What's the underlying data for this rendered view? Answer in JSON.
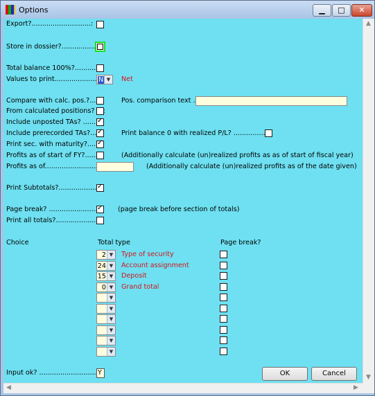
{
  "window": {
    "title": "Options"
  },
  "fields": {
    "export": {
      "label": "Export?............................:",
      "checked": false
    },
    "store": {
      "label": "Store in dossier?................:",
      "checked": false
    },
    "total_balance": {
      "label": "Total balance 100%?...........:",
      "checked": false
    },
    "values_to_print": {
      "label": "Values to print....................:",
      "value": "N",
      "hint": "Net"
    },
    "compare_calc": {
      "label": "Compare with calc. pos.?......:",
      "checked": false
    },
    "pos_comparison": {
      "label": "Pos. comparison text ...:",
      "value": ""
    },
    "from_calc": {
      "label": "From calculated positions? ...:",
      "checked": false
    },
    "include_unposted": {
      "label": "Include unposted TAs? ........:",
      "checked": true
    },
    "include_prerecorded": {
      "label": "Include prerecorded TAs?.....:",
      "checked": true
    },
    "print_balance_zero": {
      "label": "Print balance 0 with realized P/L? .................:",
      "checked": false
    },
    "print_sec_maturity": {
      "label": "Print sec. with maturity?.......:",
      "checked": true
    },
    "profits_start_fy": {
      "label": "Profits as of start of FY?........:",
      "checked": false,
      "note": "(Additionally calculate (un)realized profits as as of start of fiscal year)"
    },
    "profits_as_of": {
      "label": "Profits as of.........................:",
      "value": "",
      "note": "(Additionally calculate (un)realized profits as of the date given)"
    },
    "print_subtotals": {
      "label": "Print Subtotals?...................:",
      "checked": true
    },
    "page_break": {
      "label": "Page break? .......................:",
      "checked": true,
      "note": "(page break before section of totals)"
    },
    "print_all_totals": {
      "label": "Print all totals?....................:",
      "checked": false
    },
    "input_ok": {
      "label": "Input ok? ...........................:",
      "value": "Y"
    }
  },
  "choice": {
    "label": "Choice",
    "col_total_type": "Total type",
    "col_page_break": "Page break?",
    "rows": [
      {
        "value": "2",
        "desc": "Type of security",
        "page_break": false
      },
      {
        "value": "24",
        "desc": "Account assignment",
        "page_break": false
      },
      {
        "value": "15",
        "desc": "Deposit",
        "page_break": false
      },
      {
        "value": "0",
        "desc": "Grand total",
        "page_break": false
      },
      {
        "value": "",
        "desc": "",
        "page_break": false
      },
      {
        "value": "",
        "desc": "",
        "page_break": false
      },
      {
        "value": "",
        "desc": "",
        "page_break": false
      },
      {
        "value": "",
        "desc": "",
        "page_break": false
      },
      {
        "value": "",
        "desc": "",
        "page_break": false
      },
      {
        "value": "",
        "desc": "",
        "page_break": false
      }
    ]
  },
  "buttons": {
    "ok": "OK",
    "cancel": "Cancel"
  },
  "colors": {
    "client_bg": "#6ee0f1",
    "hint_red": "#d4141c",
    "focus_green": "#18e01a"
  }
}
